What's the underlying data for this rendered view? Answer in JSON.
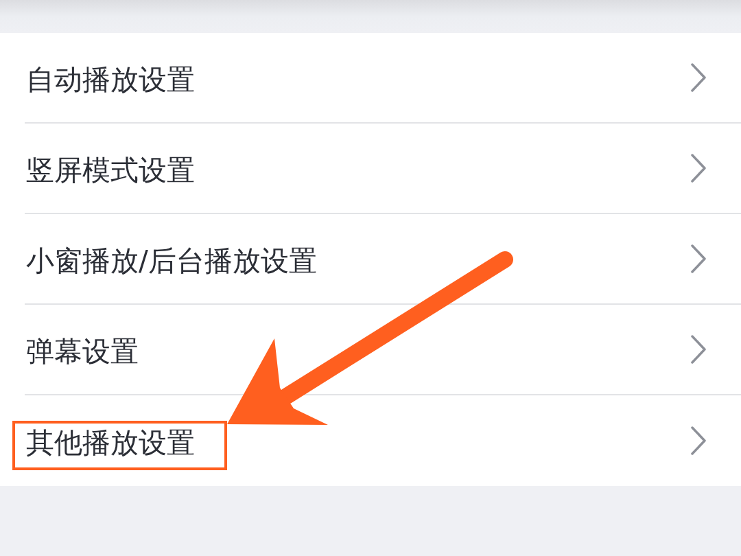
{
  "items": [
    {
      "label": "自动播放设置",
      "highlighted": false
    },
    {
      "label": "竖屏模式设置",
      "highlighted": false
    },
    {
      "label": "小窗播放/后台播放设置",
      "highlighted": false
    },
    {
      "label": "弹幕设置",
      "highlighted": false
    },
    {
      "label": "其他播放设置",
      "highlighted": true
    }
  ]
}
